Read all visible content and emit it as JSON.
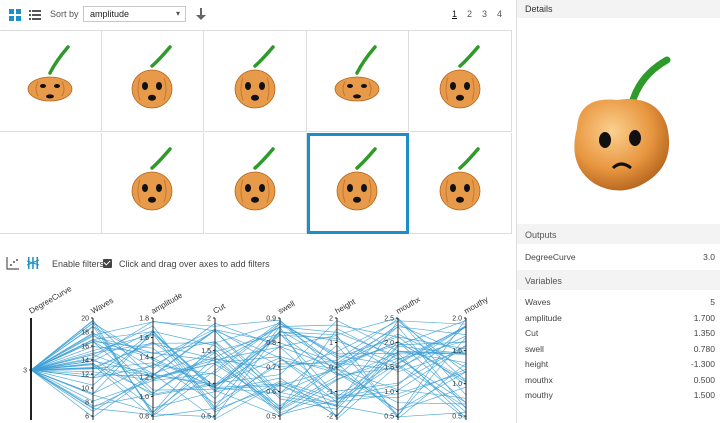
{
  "toolbar": {
    "sort_by_label": "Sort by",
    "sort_value": "amplitude",
    "pages": [
      "1",
      "2",
      "3",
      "4"
    ],
    "active_page": "1"
  },
  "filters": {
    "enable_label": "Enable filters",
    "enabled": true,
    "hint": "Click and drag over axes to add filters"
  },
  "details": {
    "title": "Details",
    "outputs_label": "Outputs",
    "outputs": [
      {
        "name": "DegreeCurve",
        "value": "3.0"
      }
    ],
    "variables_label": "Variables",
    "variables": [
      {
        "name": "Waves",
        "value": "5"
      },
      {
        "name": "amplitude",
        "value": "1.700"
      },
      {
        "name": "Cut",
        "value": "1.350"
      },
      {
        "name": "swell",
        "value": "0.780"
      },
      {
        "name": "height",
        "value": "-1.300"
      },
      {
        "name": "mouthx",
        "value": "0.500"
      },
      {
        "name": "mouthy",
        "value": "1.500"
      }
    ]
  },
  "parallel_axes": [
    {
      "name": "DegreeCurve",
      "ticks": [
        "3"
      ]
    },
    {
      "name": "Waves",
      "ticks": [
        "20",
        "18",
        "16",
        "14",
        "12",
        "10",
        "8",
        "6"
      ]
    },
    {
      "name": "amplitude",
      "ticks": [
        "1.8",
        "1.6",
        "1.4",
        "1.2",
        "1.0",
        "0.8"
      ]
    },
    {
      "name": "Cut",
      "ticks": [
        "2",
        "1.5",
        "1",
        "0.5"
      ]
    },
    {
      "name": "swell",
      "ticks": [
        "0.9",
        "0.8",
        "0.7",
        "0.6",
        "0.5"
      ]
    },
    {
      "name": "height",
      "ticks": [
        "2",
        "1",
        "0",
        "-1",
        "-2"
      ]
    },
    {
      "name": "mouthx",
      "ticks": [
        "2.5",
        "2.0",
        "1.5",
        "1.0",
        "0.5"
      ]
    },
    {
      "name": "mouthy",
      "ticks": [
        "2.0",
        "1.5",
        "1.0",
        "0.5"
      ]
    }
  ],
  "colors": {
    "accent": "#1b8fc6",
    "line": "#3a9fd4",
    "pumpkin": "#e69a4a",
    "stem": "#2e9a2a"
  }
}
